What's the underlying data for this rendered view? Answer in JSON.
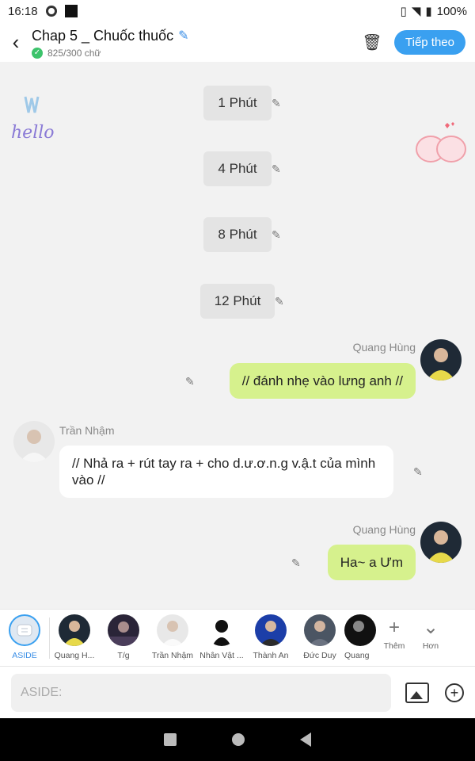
{
  "status": {
    "time": "16:18",
    "battery": "100%"
  },
  "header": {
    "title": "Chap 5 _ Chuốc thuốc",
    "word_count": "825/300 chữ",
    "next_label": "Tiếp theo"
  },
  "chat": {
    "times": [
      "1 Phút",
      "4 Phút",
      "8 Phút",
      "12 Phút"
    ],
    "messages": [
      {
        "name": "Quang Hùng",
        "text": "// đánh nhẹ vào lưng anh //"
      },
      {
        "name": "Trần Nhậm",
        "text": "// Nhả ra + rút tay ra + cho d.ư.ơ.n.g v.ậ.t của mình vào //"
      },
      {
        "name": "Quang Hùng",
        "text": "Ha~ a Ưm"
      }
    ]
  },
  "characters": [
    {
      "label": "ASIDE"
    },
    {
      "label": "Quang H..."
    },
    {
      "label": "T/g"
    },
    {
      "label": "Trần Nhậm"
    },
    {
      "label": "Nhân Vật ..."
    },
    {
      "label": "Thành An"
    },
    {
      "label": "Đức Duy"
    },
    {
      "label": "Quang"
    }
  ],
  "actions": {
    "more_label": "Thêm",
    "other_label": "Hơn"
  },
  "composer": {
    "placeholder": "ASIDE:"
  },
  "colors": {
    "accent": "#3aa0f0",
    "bubble_right": "#d6f18d"
  }
}
